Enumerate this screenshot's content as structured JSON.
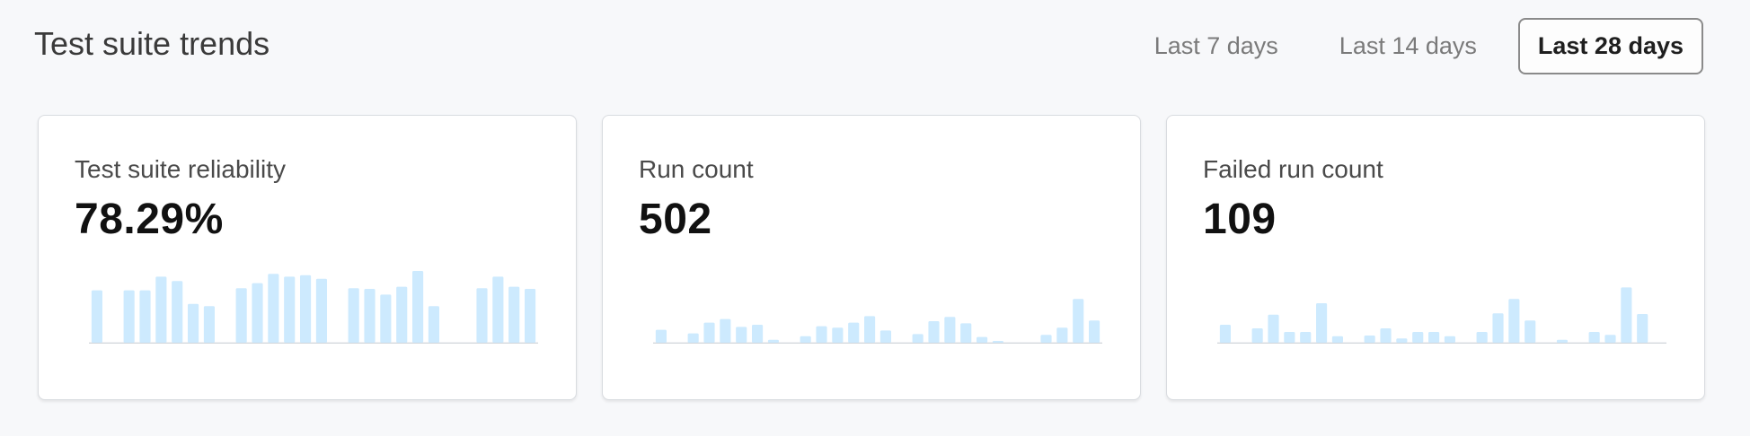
{
  "header": {
    "title": "Test suite trends"
  },
  "ranges": [
    {
      "label": "Last 7 days",
      "active": false
    },
    {
      "label": "Last 14 days",
      "active": false
    },
    {
      "label": "Last 28 days",
      "active": true
    }
  ],
  "colors": {
    "bar": "#cdeafe",
    "baseline": "#d0d4d9"
  },
  "cards": [
    {
      "label": "Test suite reliability",
      "value": "78.29%",
      "bars": [
        0.73,
        0,
        0.73,
        0.73,
        0.92,
        0.86,
        0.54,
        0.51,
        0,
        0.76,
        0.83,
        0.96,
        0.92,
        0.94,
        0.89,
        0,
        0.76,
        0.75,
        0.67,
        0.78,
        1.0,
        0.51,
        0,
        0,
        0.76,
        0.92,
        0.78,
        0.75
      ]
    },
    {
      "label": "Run count",
      "value": "502",
      "bars": [
        0.18,
        0,
        0.13,
        0.28,
        0.33,
        0.22,
        0.25,
        0.04,
        0,
        0.09,
        0.23,
        0.21,
        0.28,
        0.37,
        0.17,
        0,
        0.12,
        0.3,
        0.36,
        0.27,
        0.08,
        0.02,
        0,
        0,
        0.11,
        0.21,
        0.61,
        0.31
      ]
    },
    {
      "label": "Failed run count",
      "value": "109",
      "bars": [
        0.25,
        0,
        0.2,
        0.39,
        0.15,
        0.15,
        0.55,
        0.09,
        0,
        0.1,
        0.2,
        0.06,
        0.15,
        0.15,
        0.09,
        0,
        0.15,
        0.41,
        0.61,
        0.31,
        0,
        0.04,
        0,
        0.15,
        0.11,
        0.77,
        0.4,
        0
      ]
    }
  ]
}
